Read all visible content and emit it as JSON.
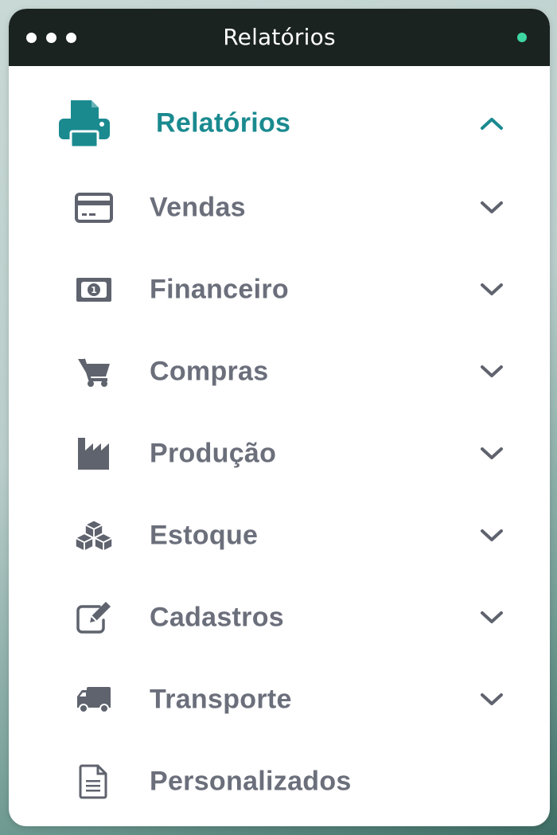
{
  "window": {
    "title": "Relatórios"
  },
  "menu": {
    "header": {
      "label": "Relatórios",
      "icon": "printer-icon",
      "expanded": true
    },
    "items": [
      {
        "label": "Vendas",
        "icon": "credit-card-icon",
        "has_submenu": true
      },
      {
        "label": "Financeiro",
        "icon": "money-bill-icon",
        "has_submenu": true
      },
      {
        "label": "Compras",
        "icon": "shopping-cart-icon",
        "has_submenu": true
      },
      {
        "label": "Produção",
        "icon": "industry-icon",
        "has_submenu": true
      },
      {
        "label": "Estoque",
        "icon": "cubes-icon",
        "has_submenu": true
      },
      {
        "label": "Cadastros",
        "icon": "edit-icon",
        "has_submenu": true
      },
      {
        "label": "Transporte",
        "icon": "truck-icon",
        "has_submenu": true
      },
      {
        "label": "Personalizados",
        "icon": "file-text-icon",
        "has_submenu": false
      }
    ]
  },
  "colors": {
    "accent": "#1a8a8f",
    "item_text": "#6b6f7b",
    "icon": "#5f636e",
    "titlebar": "#1b2321",
    "status": "#3ed6a0"
  }
}
